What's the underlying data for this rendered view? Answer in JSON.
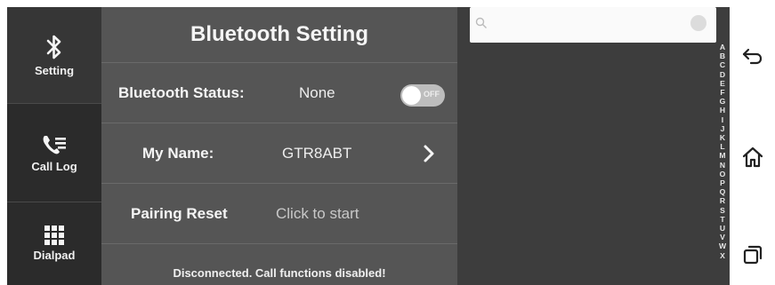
{
  "nav": {
    "items": [
      {
        "label": "Setting",
        "icon": "bluetooth-icon"
      },
      {
        "label": "Call Log",
        "icon": "call-log-icon"
      },
      {
        "label": "Dialpad",
        "icon": "dialpad-icon"
      }
    ]
  },
  "panel": {
    "title": "Bluetooth Setting",
    "status_label": "Bluetooth Status:",
    "status_value": "None",
    "toggle_text": "OFF",
    "name_label": "My Name:",
    "name_value": "GTR8ABT",
    "reset_label": "Pairing Reset",
    "reset_value": "Click to start",
    "footer": "Disconnected. Call functions disabled!"
  },
  "search": {
    "placeholder": ""
  },
  "alphabet": [
    "A",
    "B",
    "C",
    "D",
    "E",
    "F",
    "G",
    "H",
    "I",
    "J",
    "K",
    "L",
    "M",
    "N",
    "O",
    "P",
    "Q",
    "R",
    "S",
    "T",
    "U",
    "V",
    "W",
    "X"
  ],
  "system_bar": {
    "icons": [
      "back-icon",
      "home-icon",
      "recents-icon"
    ]
  },
  "colors": {
    "nav_bg": "#2b2b2b",
    "panel_bg": "#555555",
    "contacts_bg": "#3d3d3d",
    "system_bar_bg": "#ffffff"
  }
}
